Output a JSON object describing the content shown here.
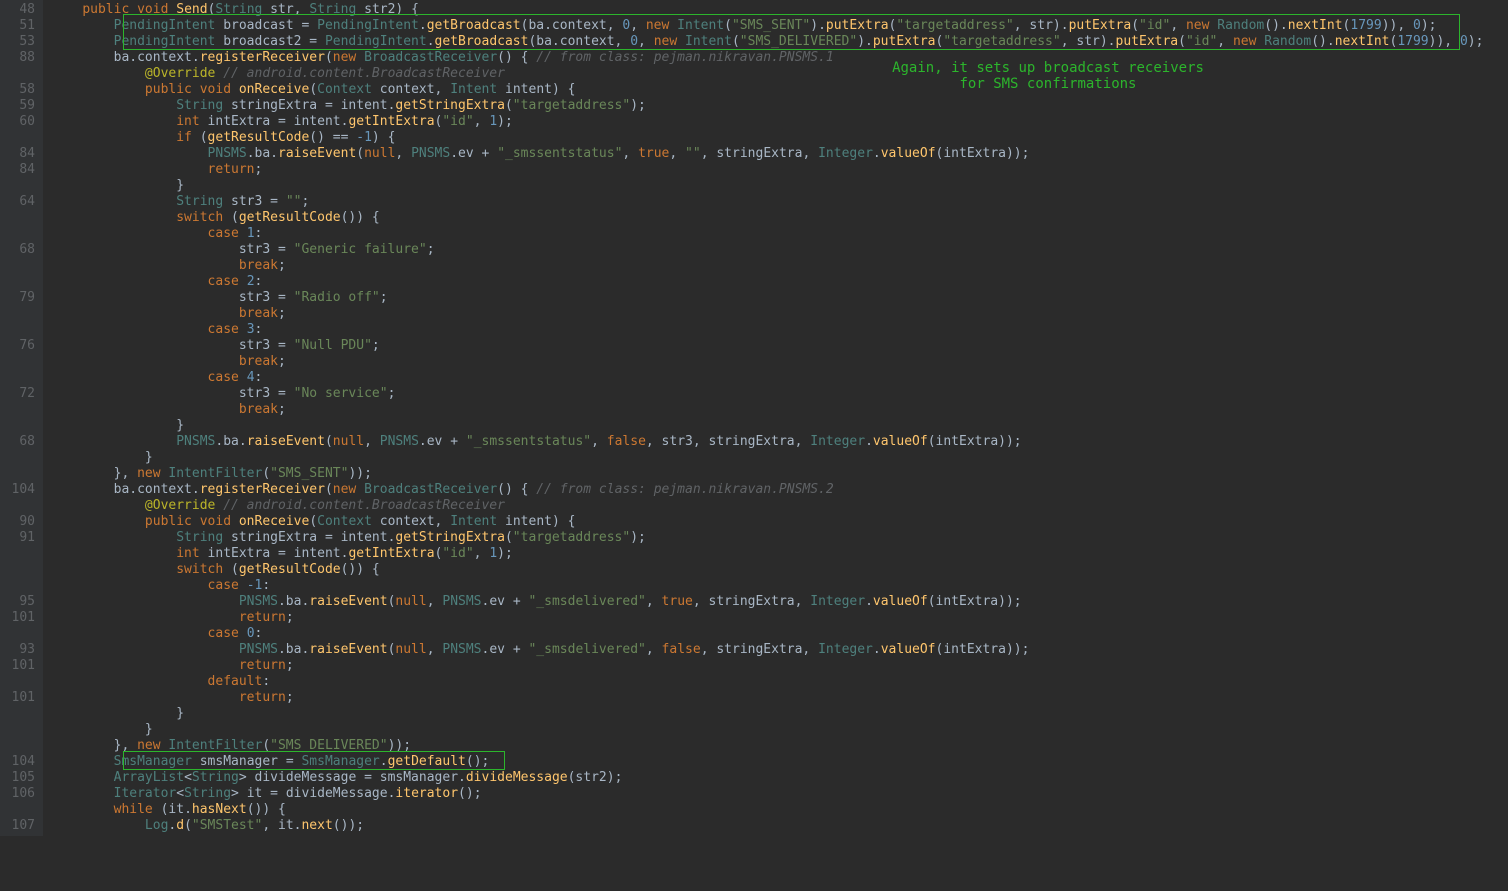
{
  "annotation": "Again, it sets up broadcast receivers for SMS confirmations",
  "gutter": [
    "48",
    "51",
    "53",
    "88",
    "",
    "58",
    "59",
    "60",
    "",
    "84",
    "84",
    "",
    "64",
    "",
    "",
    "68",
    "",
    "",
    "79",
    "",
    "",
    "76",
    "",
    "",
    "72",
    "",
    "",
    "68",
    "",
    "",
    "104",
    "",
    "90",
    "91",
    "",
    "",
    "",
    "95",
    "101",
    "",
    "93",
    "101",
    "",
    "101",
    "",
    "",
    "",
    "104",
    "105",
    "106",
    "",
    "107"
  ],
  "lines": [
    {
      "i": 1,
      "t": "    public void Send(String str, String str2) {"
    },
    {
      "i": 2,
      "t": "        PendingIntent broadcast = PendingIntent.getBroadcast(ba.context, 0, new Intent(\"SMS_SENT\").putExtra(\"targetaddress\", str).putExtra(\"id\", new Random().nextInt(1799)), 0);"
    },
    {
      "i": 2,
      "t": "        PendingIntent broadcast2 = PendingIntent.getBroadcast(ba.context, 0, new Intent(\"SMS_DELIVERED\").putExtra(\"targetaddress\", str).putExtra(\"id\", new Random().nextInt(1799)), 0);"
    },
    {
      "i": 3,
      "t": "        ba.context.registerReceiver(new BroadcastReceiver() { // from class: pejman.nikravan.PNSMS.1"
    },
    {
      "i": 4,
      "t": "            @Override // android.content.BroadcastReceiver"
    },
    {
      "i": 5,
      "t": "            public void onReceive(Context context, Intent intent) {"
    },
    {
      "i": 6,
      "t": "                String stringExtra = intent.getStringExtra(\"targetaddress\");"
    },
    {
      "i": 7,
      "t": "                int intExtra = intent.getIntExtra(\"id\", 1);"
    },
    {
      "i": 8,
      "t": "                if (getResultCode() == -1) {"
    },
    {
      "i": 9,
      "t": "                    PNSMS.ba.raiseEvent(null, PNSMS.ev + \"_smssentstatus\", true, \"\", stringExtra, Integer.valueOf(intExtra));"
    },
    {
      "i": 10,
      "t": "                    return;"
    },
    {
      "i": 11,
      "t": "                }"
    },
    {
      "i": 12,
      "t": "                String str3 = \"\";"
    },
    {
      "i": 13,
      "t": "                switch (getResultCode()) {"
    },
    {
      "i": 14,
      "t": "                    case 1:"
    },
    {
      "i": 15,
      "t": "                        str3 = \"Generic failure\";"
    },
    {
      "i": 16,
      "t": "                        break;"
    },
    {
      "i": 17,
      "t": "                    case 2:"
    },
    {
      "i": 18,
      "t": "                        str3 = \"Radio off\";"
    },
    {
      "i": 19,
      "t": "                        break;"
    },
    {
      "i": 20,
      "t": "                    case 3:"
    },
    {
      "i": 21,
      "t": "                        str3 = \"Null PDU\";"
    },
    {
      "i": 22,
      "t": "                        break;"
    },
    {
      "i": 23,
      "t": "                    case 4:"
    },
    {
      "i": 24,
      "t": "                        str3 = \"No service\";"
    },
    {
      "i": 25,
      "t": "                        break;"
    },
    {
      "i": 26,
      "t": "                }"
    },
    {
      "i": 27,
      "t": "                PNSMS.ba.raiseEvent(null, PNSMS.ev + \"_smssentstatus\", false, str3, stringExtra, Integer.valueOf(intExtra));"
    },
    {
      "i": 28,
      "t": "            }"
    },
    {
      "i": 29,
      "t": "        }, new IntentFilter(\"SMS_SENT\"));"
    },
    {
      "i": 30,
      "t": "        ba.context.registerReceiver(new BroadcastReceiver() { // from class: pejman.nikravan.PNSMS.2"
    },
    {
      "i": 31,
      "t": "            @Override // android.content.BroadcastReceiver"
    },
    {
      "i": 32,
      "t": "            public void onReceive(Context context, Intent intent) {"
    },
    {
      "i": 33,
      "t": "                String stringExtra = intent.getStringExtra(\"targetaddress\");"
    },
    {
      "i": 34,
      "t": "                int intExtra = intent.getIntExtra(\"id\", 1);"
    },
    {
      "i": 35,
      "t": "                switch (getResultCode()) {"
    },
    {
      "i": 36,
      "t": "                    case -1:"
    },
    {
      "i": 37,
      "t": "                        PNSMS.ba.raiseEvent(null, PNSMS.ev + \"_smsdelivered\", true, stringExtra, Integer.valueOf(intExtra));"
    },
    {
      "i": 38,
      "t": "                        return;"
    },
    {
      "i": 39,
      "t": "                    case 0:"
    },
    {
      "i": 40,
      "t": "                        PNSMS.ba.raiseEvent(null, PNSMS.ev + \"_smsdelivered\", false, stringExtra, Integer.valueOf(intExtra));"
    },
    {
      "i": 41,
      "t": "                        return;"
    },
    {
      "i": 42,
      "t": "                    default:"
    },
    {
      "i": 43,
      "t": "                        return;"
    },
    {
      "i": 44,
      "t": "                }"
    },
    {
      "i": 45,
      "t": "            }"
    },
    {
      "i": 46,
      "t": "        }, new IntentFilter(\"SMS_DELIVERED\"));"
    },
    {
      "i": 47,
      "t": "        SmsManager smsManager = SmsManager.getDefault();"
    },
    {
      "i": 48,
      "t": "        ArrayList<String> divideMessage = smsManager.divideMessage(str2);"
    },
    {
      "i": 49,
      "t": "        Iterator<String> it = divideMessage.iterator();"
    },
    {
      "i": 50,
      "t": "        while (it.hasNext()) {"
    },
    {
      "i": 51,
      "t": "            Log.d(\"SMSTest\", it.next());"
    }
  ]
}
